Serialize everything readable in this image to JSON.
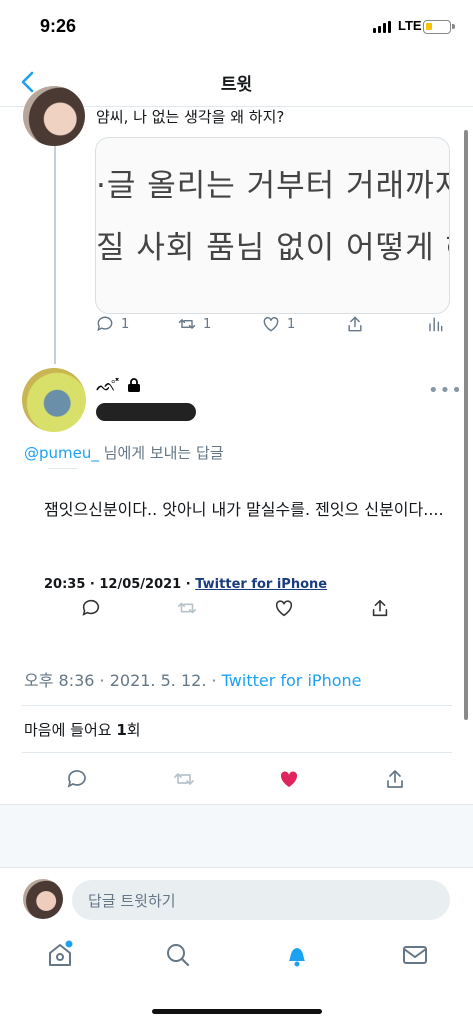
{
  "status_bar": {
    "time": "9:26",
    "network": "LTE"
  },
  "nav": {
    "title": "트윗"
  },
  "quoted_tweet": {
    "text": "얌씨, 나 없는 생각을 왜 하지?",
    "media_lines": [
      "·글 올리는 거부터 거래까지",
      "질 사회 품님 없이 어떻게 헤"
    ],
    "replies": "1",
    "retweets": "1",
    "likes": "1"
  },
  "main_tweet": {
    "name_emoji": "ᨒ̊ ̽",
    "reply_to_mention": "@pumeu_",
    "reply_to_suffix": " 님에게 보내는 답글",
    "embed": {
      "text": "잼잇으신분이다.. 앗아니 내가 말실수를. 젠잇으 신분이다....",
      "time_date": "20:35 · 12/05/2021 · ",
      "source": "Twitter for iPhone"
    },
    "timestamp": "오후 8:36 · 2021. 5. 12. · ",
    "source": "Twitter for iPhone",
    "likes_prefix": "마음에 들어요 ",
    "likes_count": "1",
    "likes_suffix": "회"
  },
  "reply_composer": {
    "placeholder": "답글 트윗하기"
  },
  "colors": {
    "accent": "#1da1f2",
    "like_active": "#e0245e",
    "muted": "#657786"
  }
}
